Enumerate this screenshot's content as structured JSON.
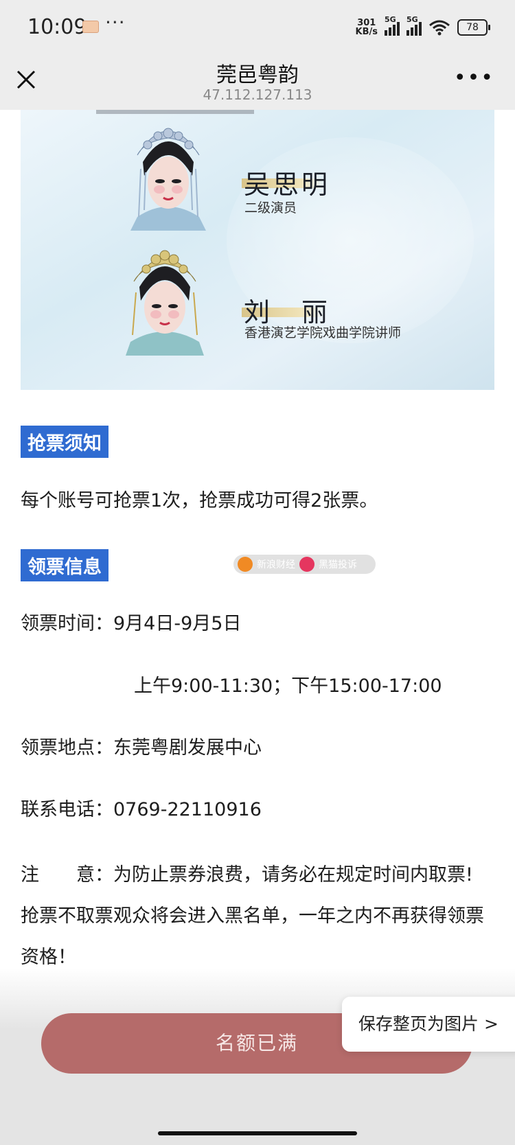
{
  "status_bar": {
    "time": "10:09",
    "more": "···",
    "net_speed_value": "301",
    "net_speed_unit": "KB/s",
    "signal1_label": "5G",
    "signal2_label": "5G",
    "battery": "78"
  },
  "nav": {
    "title": "莞邑粤韵",
    "subtitle": "47.112.127.113",
    "more": "•••"
  },
  "poster": {
    "performers": [
      {
        "name": "吴思明",
        "title": "二级演员"
      },
      {
        "name": "刘　丽",
        "title": "香港演艺学院戏曲学院讲师"
      }
    ]
  },
  "rules": {
    "heading": "抢票须知",
    "text": "每个账号可抢票1次，抢票成功可得2张票。"
  },
  "pickup": {
    "heading": "领票信息",
    "time_line": "领票时间：9月4日-9月5日",
    "time_slots": "上午9:00-11:30；下午15:00-17:00",
    "place_line": "领票地点：东莞粤剧发展中心",
    "phone_line": "联系电话：0769-22110916",
    "note_line": "注　　意：为防止票券浪费，请务必在规定时间内取票!抢票不取票观众将会进入黑名单，一年之内不再获得领票资格！"
  },
  "watermark": {
    "left_text": "新浪财经",
    "right_text": "黑猫投诉"
  },
  "actions": {
    "full_button": "名额已满",
    "save_popup": "保存整页为图片 >"
  },
  "colors": {
    "status_bg": "#ededed",
    "heading_bg": "#2f6bd1",
    "button_bg": "#b56b6a"
  }
}
